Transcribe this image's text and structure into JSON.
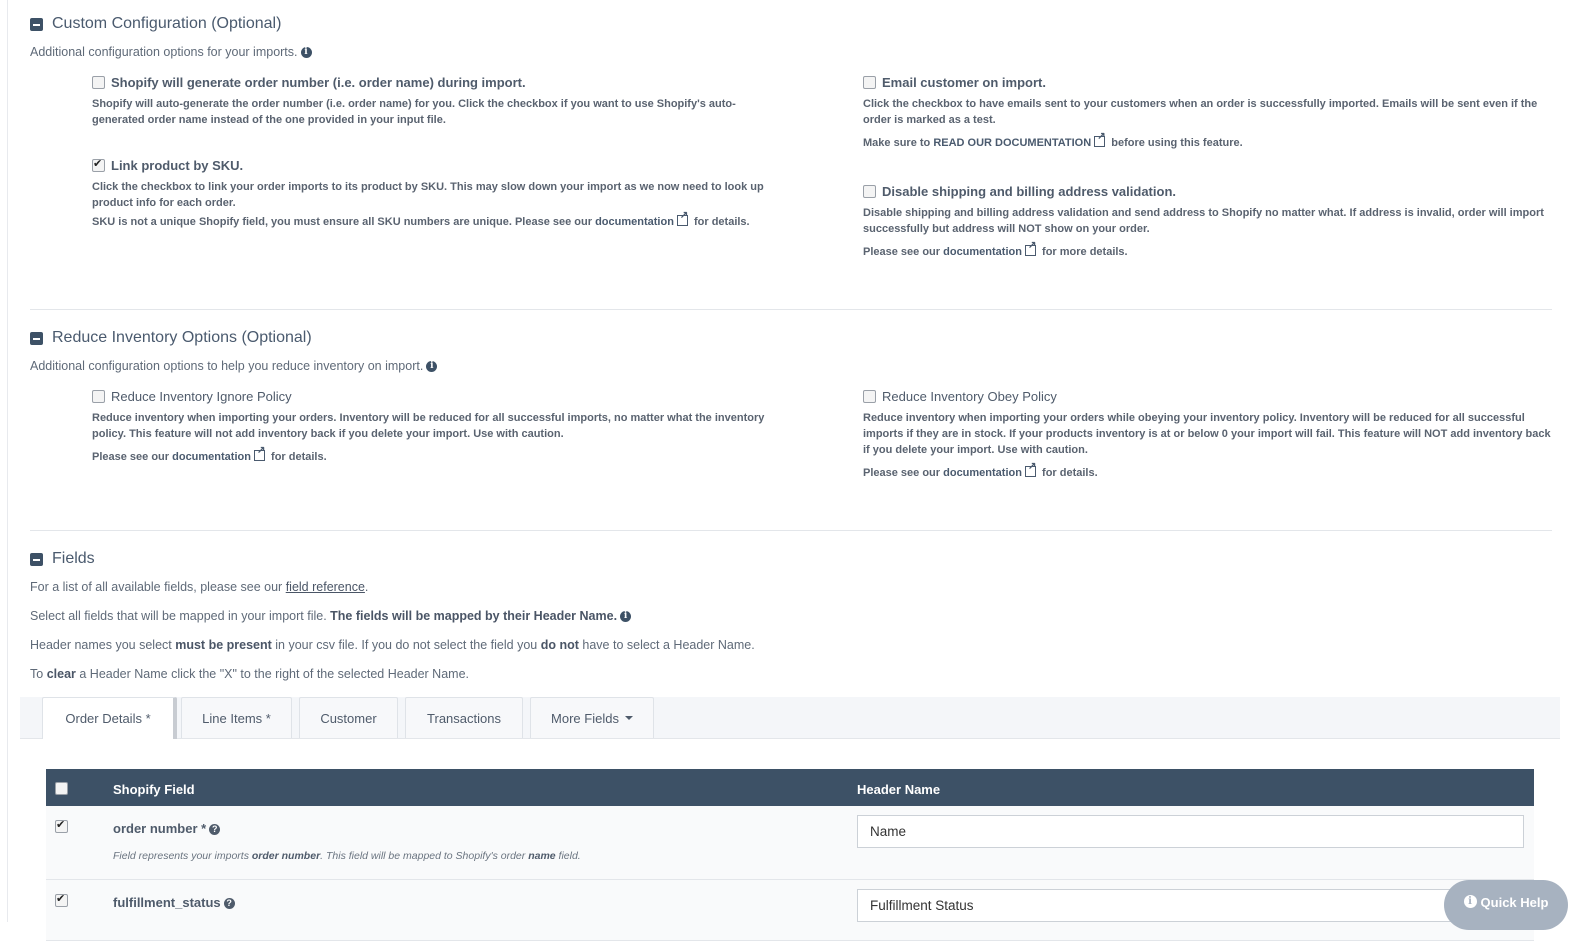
{
  "custom": {
    "title": "Custom Configuration (Optional)",
    "subtitle": "Additional configuration options for your imports.",
    "options": [
      {
        "label": "Shopify will generate order number (i.e. order name) during import.",
        "checked": false,
        "desc": "Shopify will auto-generate the order number (i.e. order name) for you. Click the checkbox if you want to use Shopify's auto-generated order name instead of the one provided in your input file."
      },
      {
        "label": "Link product by SKU.",
        "checked": true,
        "desc": "Click the checkbox to link your order imports to its product by SKU. This may slow down your import as we now need to look up product info for each order.",
        "note_pre": "SKU is not a unique Shopify field, you must ensure all SKU numbers are unique. Please see our",
        "note_link": "documentation",
        "note_post": "for details."
      },
      {
        "label": "Email customer on import.",
        "checked": false,
        "desc": "Click the checkbox to have emails sent to your customers when an order is successfully imported. Emails will be sent even if the order is marked as a test.",
        "note_pre": "Make sure to",
        "note_link": "READ OUR DOCUMENTATION",
        "note_post": "before using this feature."
      },
      {
        "label": "Disable shipping and billing address validation.",
        "checked": false,
        "desc": "Disable shipping and billing address validation and send address to Shopify no matter what. If address is invalid, order will import successfully but address will NOT show on your order.",
        "note_pre": "Please see our",
        "note_link": "documentation",
        "note_post": "for more details."
      }
    ]
  },
  "inventory": {
    "title": "Reduce Inventory Options (Optional)",
    "subtitle": "Additional configuration options to help you reduce inventory on import.",
    "options": [
      {
        "label": "Reduce Inventory Ignore Policy",
        "checked": false,
        "desc": "Reduce inventory when importing your orders. Inventory will be reduced for all successful imports, no matter what the inventory policy. This feature will not add inventory back if you delete your import. Use with caution.",
        "note_pre": "Please see our",
        "note_link": "documentation",
        "note_post": "for details."
      },
      {
        "label": "Reduce Inventory Obey Policy",
        "checked": false,
        "desc": "Reduce inventory when importing your orders while obeying your inventory policy. Inventory will be reduced for all successful imports if they are in stock. If your products inventory is at or below 0 your import will fail. This feature will NOT add inventory back if you delete your import. Use with caution.",
        "note_pre": "Please see our",
        "note_link": "documentation",
        "note_post": "for details."
      }
    ]
  },
  "fields": {
    "title": "Fields",
    "line1_pre": "For a list of all available fields, please see our",
    "line1_link": "field reference",
    "line1_post": ".",
    "line2_pre": "Select all fields that will be mapped in your import file.",
    "line2_bold": "The fields will be mapped by their Header Name.",
    "line3_a": "Header names you select",
    "line3_b": "must be present",
    "line3_c": "in your csv file. If you do not select the field you",
    "line3_d": "do not",
    "line3_e": "have to select a Header Name.",
    "line4_a": "To",
    "line4_b": "clear",
    "line4_c": "a Header Name click the \"X\" to the right of the selected Header Name."
  },
  "tabs": [
    "Order Details *",
    "Line Items *",
    "Customer",
    "Transactions",
    "More Fields"
  ],
  "table": {
    "col1": "Shopify Field",
    "col2": "Header Name",
    "rows": [
      {
        "field": "order number *",
        "checked": true,
        "desc_a": "Field represents your imports",
        "desc_b": "order number",
        "desc_c": ". This field will be mapped to Shopify's order",
        "desc_d": "name",
        "desc_e": "field.",
        "header": "Name"
      },
      {
        "field": "fulfillment_status",
        "checked": true,
        "header": "Fulfillment Status"
      }
    ]
  },
  "quick_help": "Quick Help"
}
